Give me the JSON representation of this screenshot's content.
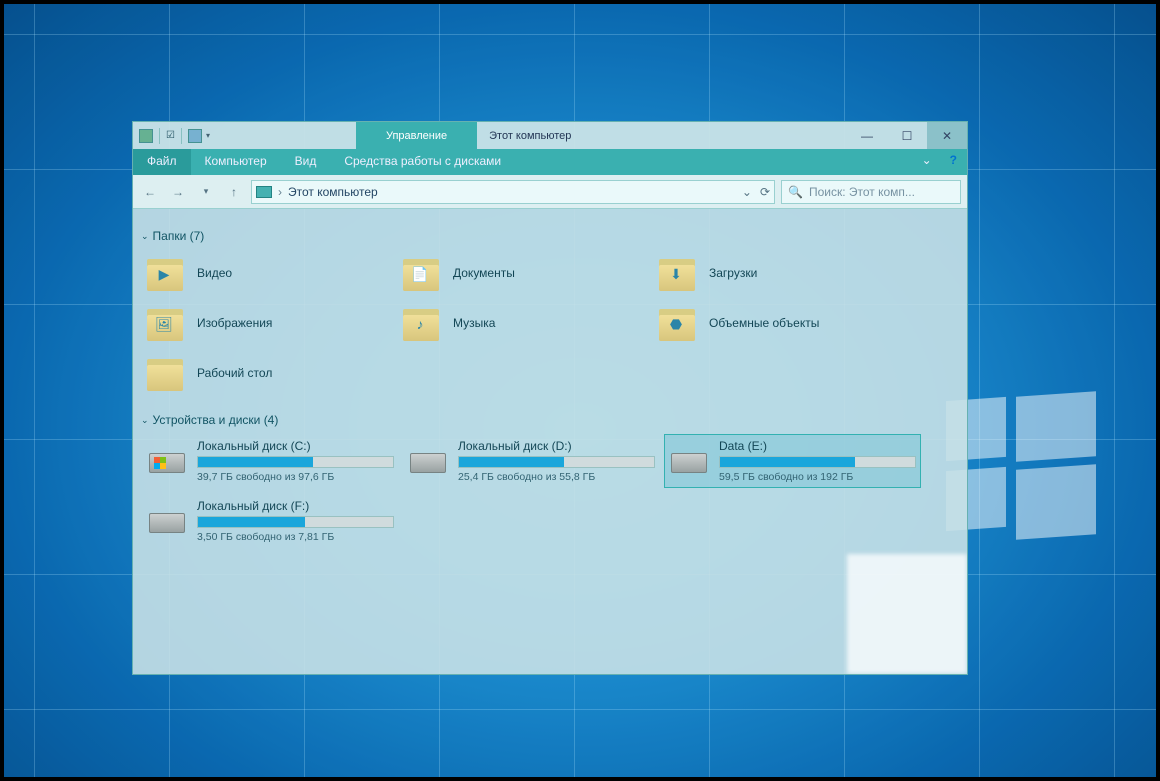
{
  "window": {
    "context_tab": "Управление",
    "title": "Этот компьютер"
  },
  "ribbon": {
    "file": "Файл",
    "computer": "Компьютер",
    "view": "Вид",
    "disk_tools": "Средства работы с дисками"
  },
  "nav": {
    "crumb": "Этот компьютер",
    "search_placeholder": "Поиск: Этот комп..."
  },
  "groups": {
    "folders_header": "Папки (7)",
    "drives_header": "Устройства и диски (4)"
  },
  "folders": [
    {
      "label": "Видео",
      "badge": "▶"
    },
    {
      "label": "Документы",
      "badge": "📄"
    },
    {
      "label": "Загрузки",
      "badge": "⬇"
    },
    {
      "label": "Изображения",
      "badge": "🖼"
    },
    {
      "label": "Музыка",
      "badge": "♪"
    },
    {
      "label": "Объемные объекты",
      "badge": "⬣"
    },
    {
      "label": "Рабочий стол",
      "badge": ""
    }
  ],
  "drives": [
    {
      "name": "Локальный диск (C:)",
      "free": "39,7 ГБ свободно из 97,6 ГБ",
      "pct": 59,
      "win": true,
      "selected": false
    },
    {
      "name": "Локальный диск (D:)",
      "free": "25,4 ГБ свободно из 55,8 ГБ",
      "pct": 54,
      "win": false,
      "selected": false
    },
    {
      "name": "Data (E:)",
      "free": "59,5 ГБ свободно из 192 ГБ",
      "pct": 69,
      "win": false,
      "selected": true
    },
    {
      "name": "Локальный диск (F:)",
      "free": "3,50 ГБ свободно из 7,81 ГБ",
      "pct": 55,
      "win": false,
      "selected": false
    }
  ]
}
